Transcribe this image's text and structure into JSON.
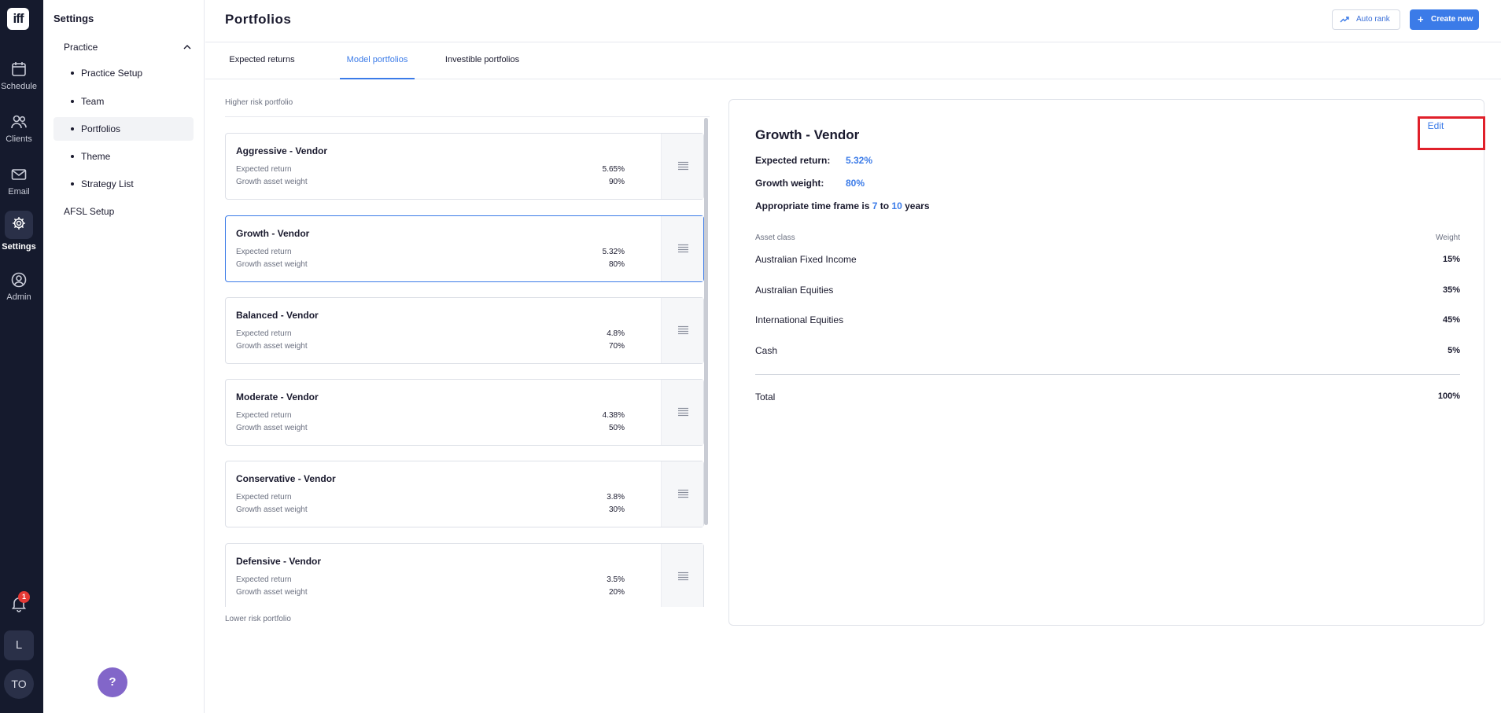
{
  "app": {
    "logo_text": "iff"
  },
  "rail": {
    "items": [
      {
        "label": "Schedule",
        "icon": "calendar-icon"
      },
      {
        "label": "Clients",
        "icon": "users-icon"
      },
      {
        "label": "Email",
        "icon": "mail-icon"
      },
      {
        "label": "Settings",
        "icon": "gear-icon",
        "active": true
      },
      {
        "label": "Admin",
        "icon": "user-circle-icon"
      }
    ],
    "notification_count": "1",
    "workspace_initial": "L",
    "user_initials": "TO"
  },
  "settings": {
    "title": "Settings",
    "section": "Practice",
    "items": [
      {
        "label": "Practice Setup"
      },
      {
        "label": "Team"
      },
      {
        "label": "Portfolios",
        "active": true
      },
      {
        "label": "Theme"
      },
      {
        "label": "Strategy List"
      }
    ],
    "afsl": "AFSL Setup",
    "help_label": "?"
  },
  "header": {
    "title": "Portfolios",
    "auto_rank_label": "Auto rank",
    "create_new_label": "Create new"
  },
  "tabs": [
    {
      "label": "Expected returns"
    },
    {
      "label": "Model portfolios",
      "active": true
    },
    {
      "label": "Investible portfolios"
    }
  ],
  "list": {
    "top_hint": "Higher risk portfolio",
    "bottom_hint": "Lower risk portfolio",
    "expected_return_label": "Expected return",
    "growth_weight_label": "Growth asset weight",
    "portfolios": [
      {
        "name": "Aggressive - Vendor",
        "expected_return": "5.65%",
        "growth_weight": "90%"
      },
      {
        "name": "Growth - Vendor",
        "expected_return": "5.32%",
        "growth_weight": "80%",
        "selected": true
      },
      {
        "name": "Balanced - Vendor",
        "expected_return": "4.8%",
        "growth_weight": "70%"
      },
      {
        "name": "Moderate - Vendor",
        "expected_return": "4.38%",
        "growth_weight": "50%"
      },
      {
        "name": "Conservative - Vendor",
        "expected_return": "3.8%",
        "growth_weight": "30%"
      },
      {
        "name": "Defensive - Vendor",
        "expected_return": "3.5%",
        "growth_weight": "20%"
      }
    ]
  },
  "detail": {
    "title": "Growth - Vendor",
    "edit_label": "Edit",
    "expected_return_label": "Expected return:",
    "expected_return_value": "5.32%",
    "growth_weight_label": "Growth weight:",
    "growth_weight_value": "80%",
    "timeframe_prefix": "Appropriate time frame is",
    "timeframe_min": "7",
    "timeframe_to": "to",
    "timeframe_max": "10",
    "timeframe_suffix": "years",
    "asset_class_header": "Asset class",
    "weight_header": "Weight",
    "assets": [
      {
        "name": "Australian Fixed Income",
        "weight": "15%"
      },
      {
        "name": "Australian Equities",
        "weight": "35%"
      },
      {
        "name": "International Equities",
        "weight": "45%"
      },
      {
        "name": "Cash",
        "weight": "5%"
      }
    ],
    "total_label": "Total",
    "total_value": "100%"
  },
  "colors": {
    "rail_bg": "#151a2d",
    "accent": "#3b7be8",
    "highlight": "#e0202a",
    "help_bg": "#8266c9"
  }
}
